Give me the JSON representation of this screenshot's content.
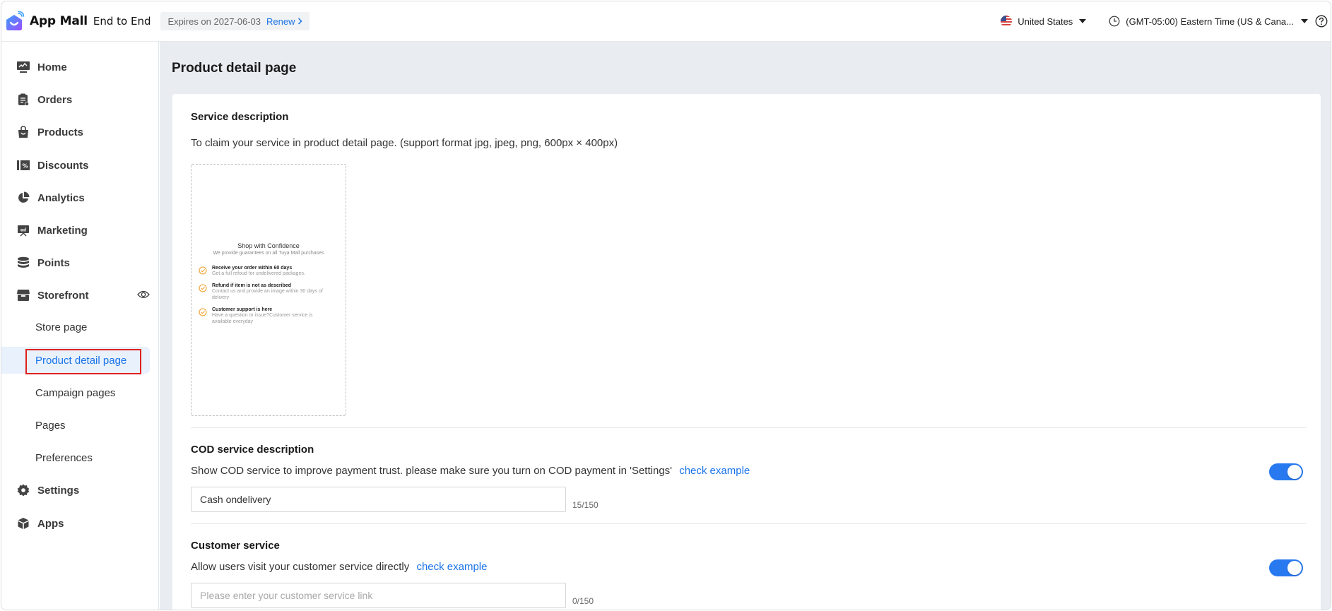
{
  "header": {
    "brand": "App Mall",
    "brand_sub": "End to End",
    "expiry_text": "Expires on 2027-06-03",
    "renew_label": "Renew",
    "country": "United States",
    "timezone": "(GMT-05:00) Eastern Time (US & Cana...",
    "icons": {
      "logo": "app-mall-logo",
      "flag": "us-flag-icon",
      "clock": "clock-icon",
      "help": "help-icon"
    }
  },
  "sidebar": {
    "items": [
      {
        "label": "Home",
        "icon": "monitor-chart-icon"
      },
      {
        "label": "Orders",
        "icon": "clipboard-icon"
      },
      {
        "label": "Products",
        "icon": "shopping-bag-icon"
      },
      {
        "label": "Discounts",
        "icon": "coupon-icon"
      },
      {
        "label": "Analytics",
        "icon": "pie-chart-icon"
      },
      {
        "label": "Marketing",
        "icon": "presentation-icon"
      },
      {
        "label": "Points",
        "icon": "coin-stack-icon"
      },
      {
        "label": "Storefront",
        "icon": "store-icon"
      },
      {
        "label": "Settings",
        "icon": "gear-icon"
      },
      {
        "label": "Apps",
        "icon": "cube-icon"
      }
    ],
    "storefront_sub": [
      {
        "label": "Store page",
        "active": false
      },
      {
        "label": "Product detail page",
        "active": true
      },
      {
        "label": "Campaign pages",
        "active": false
      },
      {
        "label": "Pages",
        "active": false
      },
      {
        "label": "Preferences",
        "active": false
      }
    ]
  },
  "main": {
    "title": "Product detail page",
    "service": {
      "title": "Service description",
      "desc": "To claim your service in product detail page. (support format jpg, jpeg, png, 600px × 400px)",
      "preview": {
        "title": "Shop with Confidence",
        "subtitle": "We provide guarantees on all Tuya Mall purchases",
        "items": [
          {
            "heading": "Receive your order within 60 days",
            "body": "Get a full refoud for undelivered packages."
          },
          {
            "heading": "Refund if item is not as described",
            "body": "Contact us and provide an image within 30 days of delivery"
          },
          {
            "heading": "Customer support is here",
            "body": "Have a question or issue?Customer service is available everyday"
          }
        ]
      }
    },
    "cod": {
      "title": "COD service description",
      "desc": "Show COD service to improve payment trust. please make sure you turn on COD payment in 'Settings'",
      "link": "check example",
      "value": "Cash ondelivery",
      "counter": "15/150",
      "enabled": true
    },
    "customer_service": {
      "title": "Customer service",
      "desc": "Allow users visit your customer service directly",
      "link": "check example",
      "placeholder": "Please enter your customer service link",
      "value": "",
      "counter": "0/150",
      "enabled": true
    }
  },
  "colors": {
    "accent": "#1a73e8",
    "toggle_on": "#2879f0",
    "check_orange": "#f0a030",
    "highlight": "#e02020",
    "main_bg": "#e9edf1"
  }
}
